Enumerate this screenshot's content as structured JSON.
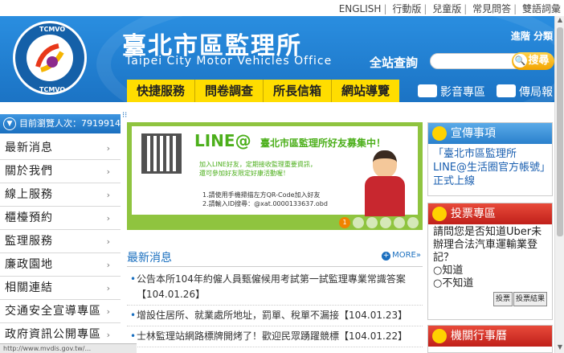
{
  "toplinks": [
    "ENGLISH",
    "行動版",
    "兒童版",
    "常見問答",
    "雙語詞彙"
  ],
  "header": {
    "logo_text": "TCMVO",
    "title_cn": "臺北市區監理所",
    "title_en": "Taipei City Motor Vehicles Office",
    "advanced_search": "進階 分類",
    "site_search_label": "全站查詢",
    "search_placeholder": "",
    "search_button": "搜尋"
  },
  "mainnav": [
    "快捷服務",
    "問卷調查",
    "所長信箱",
    "網站導覽"
  ],
  "subnav": [
    {
      "icon": "video-icon",
      "label": "影音專區"
    },
    {
      "icon": "mail-icon",
      "label": "傳局報"
    }
  ],
  "visitors": "目前瀏覽人次：7919914",
  "sidebar": [
    "最新消息",
    "關於我們",
    "線上服務",
    "櫃檯預約",
    "監理服務",
    "廉政園地",
    "相關連結",
    "交通安全宣導專區",
    "政府資訊公開專區"
  ],
  "banner": {
    "line_title": "LINE@",
    "line_subtitle": "臺北市區監理所好友募集中！",
    "desc_1": "加入LINE好友，定期接收監理重要資訊，",
    "desc_2": "還可參加好友限定好康活動喔！",
    "step_1": "1.請使用手機掃描左方QR-Code加入好友",
    "step_2": "2.請輸入ID搜尋：@xat.0000133637.obd",
    "dots": [
      "1",
      "",
      "",
      "",
      "",
      ""
    ]
  },
  "news": {
    "title": "最新消息",
    "more": "MORE»",
    "items": [
      {
        "text": "公告本所104年約僱人員甄僱候用考試第一試監理專業常識答案",
        "date": "【104.01.26】"
      },
      {
        "text": "增設住居所、就業處所地址，罰單、稅單不漏接",
        "date": "【104.01.23】"
      },
      {
        "text": "士林監理站網路標牌開烤了！歡迎民眾踴躍競標",
        "date": "【104.01.22】"
      }
    ]
  },
  "promo": {
    "title": "宣傳事項",
    "text": "「臺北市區監理所LINE@生活圈官方帳號」正式上線"
  },
  "poll": {
    "title": "投票專區",
    "question": "請問您是否知道Uber未辦理合法汽車運輸業登記？",
    "options": [
      "知道",
      "不知道"
    ],
    "vote": "投票",
    "results": "投票結果"
  },
  "calendar": {
    "title": "機關行事曆"
  },
  "statusbar": "http://www.mvdis.gov.tw/..."
}
